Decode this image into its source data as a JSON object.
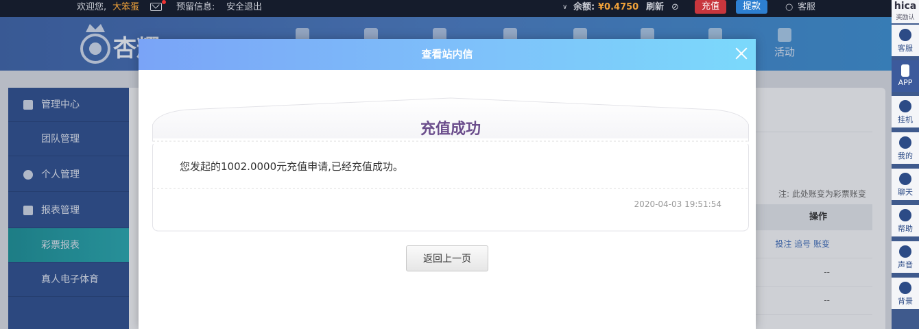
{
  "topbar": {
    "welcome": "欢迎您,",
    "username": "大笨蛋",
    "reserved_info": "预留信息:",
    "logout": "安全退出",
    "balance_label": "余额:",
    "balance_value": "¥0.4750",
    "refresh": "刷新",
    "recharge": "充值",
    "withdraw": "提款",
    "service": "客服"
  },
  "navbar": {
    "logo_text": "杏耀",
    "activity_label": "活动"
  },
  "leftmenu": {
    "items": [
      {
        "label": "管理中心"
      },
      {
        "label": "团队管理"
      },
      {
        "label": "个人管理"
      },
      {
        "label": "报表管理"
      },
      {
        "label": "彩票报表"
      },
      {
        "label": "真人电子体育"
      }
    ]
  },
  "background": {
    "note": "注: 此处账变为彩票账变",
    "col_header": "操作",
    "row1_actions": "投注 追号 账变",
    "row2_value": "--",
    "row3_value": "--"
  },
  "rightbar": {
    "top_line1": "hica",
    "top_line2": "奖励认",
    "items": [
      {
        "label": "客服"
      },
      {
        "label": "APP"
      },
      {
        "label": "挂机"
      },
      {
        "label": "我的"
      },
      {
        "label": "聊天"
      },
      {
        "label": "帮助"
      },
      {
        "label": "声音"
      },
      {
        "label": "背景"
      }
    ]
  },
  "modal": {
    "title": "查看站内信",
    "message_title": "充值成功",
    "message_body": "您发起的1002.0000元充值申请,已经充值成功。",
    "timestamp": "2020-04-03 19:51:54",
    "back_button": "返回上一页"
  }
}
